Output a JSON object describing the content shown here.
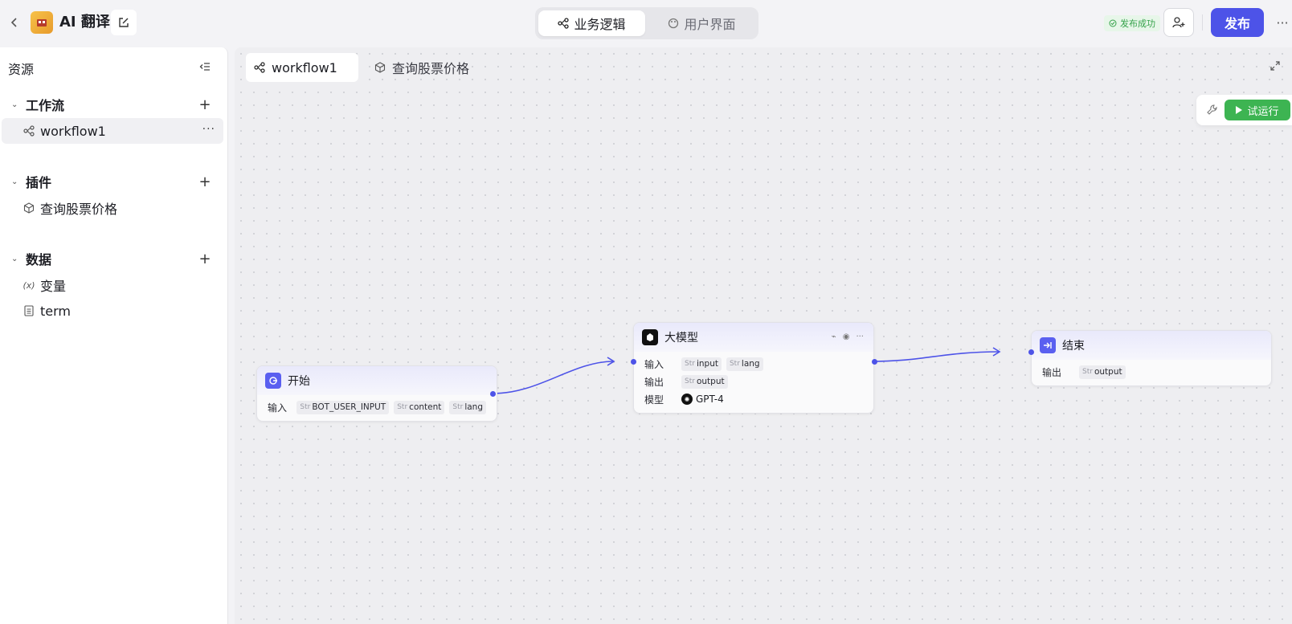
{
  "app": {
    "title": "AI 翻译"
  },
  "mode_tabs": [
    {
      "label": "业务逻辑",
      "icon": "workflow-icon",
      "active": true
    },
    {
      "label": "用户界面",
      "icon": "palette-icon",
      "active": false
    }
  ],
  "header": {
    "publish_status": "发布成功",
    "publish_label": "发布"
  },
  "sidebar": {
    "title": "资源",
    "groups": [
      {
        "label": "工作流",
        "items": [
          {
            "label": "workflow1",
            "icon": "workflow-icon"
          }
        ]
      },
      {
        "label": "插件",
        "items": [
          {
            "label": "查询股票价格",
            "icon": "cube-icon"
          }
        ]
      },
      {
        "label": "数据",
        "items": [
          {
            "label": "变量",
            "icon": "variable-icon",
            "icon_text": "(x)"
          },
          {
            "label": "term",
            "icon": "document-icon"
          }
        ]
      }
    ]
  },
  "canvas": {
    "tabs": [
      {
        "label": "workflow1",
        "icon": "workflow-icon",
        "active": true
      },
      {
        "label": "查询股票价格",
        "icon": "cube-icon",
        "active": false
      }
    ],
    "run_label": "试运行",
    "nodes": {
      "start": {
        "title": "开始",
        "rows": [
          {
            "label": "输入",
            "tags": [
              "BOT_USER_INPUT",
              "content",
              "lang"
            ]
          }
        ]
      },
      "llm": {
        "title": "大模型",
        "rows": [
          {
            "label": "输入",
            "tags": [
              "input",
              "lang"
            ]
          },
          {
            "label": "输出",
            "tags": [
              "output"
            ]
          }
        ],
        "model_label": "模型",
        "model_name": "GPT-4"
      },
      "end": {
        "title": "结束",
        "rows": [
          {
            "label": "输出",
            "tags": [
              "output"
            ]
          }
        ]
      }
    },
    "tag_type_prefix": "Str"
  },
  "colors": {
    "accent": "#4d53e8",
    "run": "#3db452",
    "success": "#35a24a"
  }
}
